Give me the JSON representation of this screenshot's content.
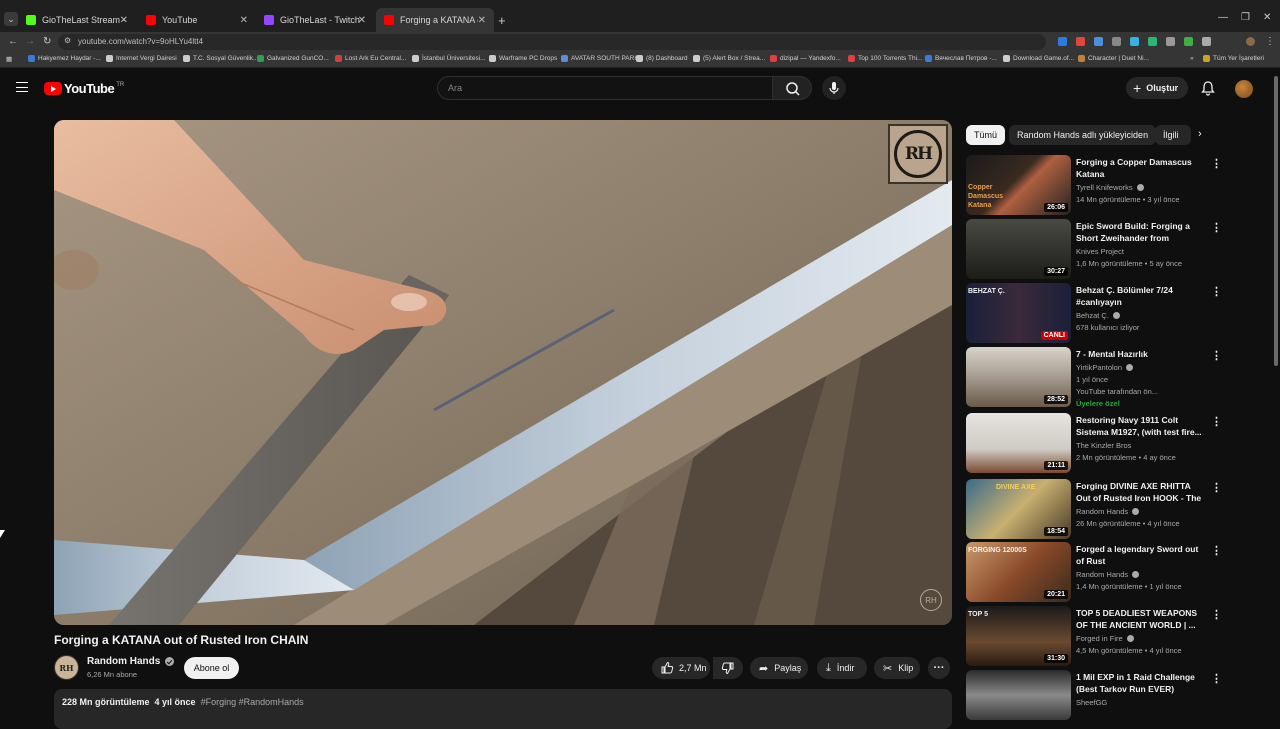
{
  "browser": {
    "tabs": [
      {
        "title": "GioTheLast Stream - Watch Live",
        "color": "#53fc18"
      },
      {
        "title": "YouTube",
        "color": "#ff0000"
      },
      {
        "title": "GioTheLast - Twitch",
        "color": "#9146ff"
      },
      {
        "title": "Forging a KATANA out of R",
        "color": "#ff0000",
        "active": true
      }
    ],
    "url": "youtube.com/watch?v=9oHLYu4ltt4",
    "bookmarks": [
      {
        "label": "Hakyemez Haydar -...",
        "color": "#3a7bd5"
      },
      {
        "label": "Internet Vergi Dairesi",
        "color": "#cccccc"
      },
      {
        "label": "T.C. Sosyal Güvenlik...",
        "color": "#cccccc"
      },
      {
        "label": "Galvanized GunCO...",
        "color": "#2e9e4f"
      },
      {
        "label": "Lost Ark Eu Central...",
        "color": "#d04040"
      },
      {
        "label": "İstanbul Üniversitesi...",
        "color": "#cccccc"
      },
      {
        "label": "Warframe PC Drops",
        "color": "#cccccc"
      },
      {
        "label": "AVATAR SOUTH PARK",
        "color": "#5b8fd8"
      },
      {
        "label": "(8) Dashboard",
        "color": "#cccccc"
      },
      {
        "label": "(5) Alert Box / Strea...",
        "color": "#cccccc"
      },
      {
        "label": "dizipal — Yandexfo...",
        "color": "#e04040"
      },
      {
        "label": "Top 100 Torrents Thi...",
        "color": "#e04040"
      },
      {
        "label": "Вячеслав Петров -...",
        "color": "#3a7bd5"
      },
      {
        "label": "Download Game.of...",
        "color": "#cccccc"
      },
      {
        "label": "Character | Duet Ni...",
        "color": "#c08040"
      }
    ],
    "all_bookmarks": "Tüm Yer İşaretleri"
  },
  "yt": {
    "logo": "YouTube",
    "country": "TR",
    "search_placeholder": "Ara",
    "create_label": "Oluştur",
    "brand_color": "#ff0000"
  },
  "video": {
    "title": "Forging a KATANA out of Rusted Iron CHAIN",
    "channel": "Random Hands",
    "subscribers": "6,26 Mn abone",
    "subscribe_label": "Abone ol",
    "likes": "2,7 Mn",
    "share_label": "Paylaş",
    "download_label": "İndir",
    "clip_label": "Klip",
    "views": "228 Mn görüntüleme",
    "age": "4 yıl önce",
    "tags": "#Forging #RandomHands",
    "watermark_text": "RH"
  },
  "sidebar": {
    "chips": [
      "Tümü",
      "Random Hands adlı yükleyiciden",
      "İlgili"
    ],
    "recs": [
      {
        "title": "Forging a Copper Damascus Katana",
        "channel": "Tyrell Knifeworks",
        "verified": true,
        "meta": "14 Mn görüntüleme • 3 yıl önce",
        "duration": "26:06",
        "overlay": "Copper Damascus Katana"
      },
      {
        "title": "Epic Sword Build: Forging a Short Zweihander from Bearin...",
        "channel": "Knives Project",
        "verified": false,
        "meta": "1,6 Mn görüntüleme • 5 ay önce",
        "duration": "30:27"
      },
      {
        "title": "Behzat Ç. Bölümler 7/24 #canlıyayın",
        "channel": "Behzat Ç.",
        "verified": true,
        "meta": "678 kullanıcı izliyor",
        "live": "CANLI",
        "overlay": "BEHZAT Ç."
      },
      {
        "title": "7 - Mental Hazırlık",
        "channel": "YirtikPantolon",
        "verified": true,
        "meta": "1 yıl önce",
        "meta2": "YouTube tarafından ön...",
        "member": "Üyelere özel",
        "duration": "28:52"
      },
      {
        "title": "Restoring Navy 1911 Colt Sistema M1927, (with test fire...",
        "channel": "The Kinzler Bros",
        "verified": false,
        "meta": "2 Mn görüntüleme • 4 ay önce",
        "duration": "21:11"
      },
      {
        "title": "Forging DIVINE AXE RHITTA Out of Rusted Iron HOOK - The ...",
        "channel": "Random Hands",
        "verified": true,
        "meta": "26 Mn görüntüleme • 4 yıl önce",
        "duration": "18:54",
        "overlay": "DIVINE AXE"
      },
      {
        "title": "Forged a legendary Sword out of Rust",
        "channel": "Random Hands",
        "verified": true,
        "meta": "1,4 Mn görüntüleme • 1 yıl önce",
        "duration": "20:21",
        "overlay": "FORGING 12000S"
      },
      {
        "title": "TOP 5 DEADLIEST WEAPONS OF THE ANCIENT WORLD | ...",
        "channel": "Forged in Fire",
        "verified": true,
        "meta": "4,5 Mn görüntüleme • 4 yıl önce",
        "duration": "31:30",
        "overlay": "TOP 5"
      },
      {
        "title": "1 Mil EXP in 1 Raid Challenge (Best Tarkov Run EVER)",
        "channel": "SheefGG",
        "verified": false,
        "meta": ""
      }
    ]
  }
}
